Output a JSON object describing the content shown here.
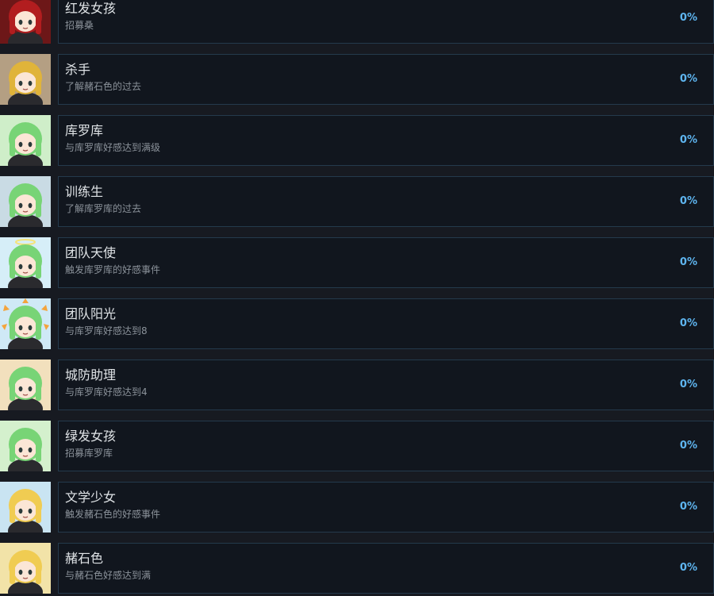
{
  "achievements": [
    {
      "title": "红发女孩",
      "description": "招募桑",
      "percent": "0%",
      "icon": "red-hair-girl-icon",
      "hair": "#b21d1f",
      "bg": "#6d1718"
    },
    {
      "title": "杀手",
      "description": "了解赭石色的过去",
      "percent": "0%",
      "icon": "killer-icon",
      "hair": "#e0b43a",
      "bg": "#b49f83"
    },
    {
      "title": "库罗库",
      "description": "与库罗库好感达到满级",
      "percent": "0%",
      "icon": "kuroku-icon",
      "hair": "#78d476",
      "bg": "#cfeec9"
    },
    {
      "title": "训练生",
      "description": "了解库罗库的过去",
      "percent": "0%",
      "icon": "trainee-icon",
      "hair": "#78d476",
      "bg": "#c9dbe4"
    },
    {
      "title": "团队天使",
      "description": "触发库罗库的好感事件",
      "percent": "0%",
      "icon": "team-angel-icon",
      "hair": "#78d476",
      "bg": "#d6eef8"
    },
    {
      "title": "团队阳光",
      "description": "与库罗库好感达到8",
      "percent": "0%",
      "icon": "team-sunshine-icon",
      "hair": "#78d476",
      "bg": "#cfe9f6"
    },
    {
      "title": "城防助理",
      "description": "与库罗库好感达到4",
      "percent": "0%",
      "icon": "city-defense-assistant-icon",
      "hair": "#78d476",
      "bg": "#f2e0bd"
    },
    {
      "title": "绿发女孩",
      "description": "招募库罗库",
      "percent": "0%",
      "icon": "green-hair-girl-icon",
      "hair": "#78d476",
      "bg": "#d4f0cd"
    },
    {
      "title": "文学少女",
      "description": "触发赭石色的好感事件",
      "percent": "0%",
      "icon": "literature-girl-icon",
      "hair": "#f0cc52",
      "bg": "#c9e4f2"
    },
    {
      "title": "赭石色",
      "description": "与赭石色好感达到满",
      "percent": "0%",
      "icon": "ochre-icon",
      "hair": "#f0cc52",
      "bg": "#f2e3a8"
    }
  ]
}
